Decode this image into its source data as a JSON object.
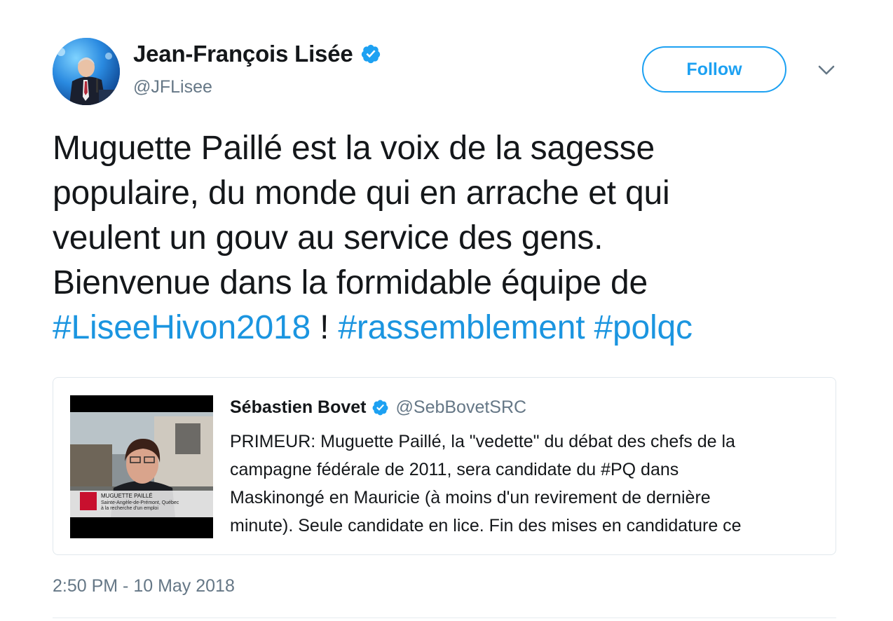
{
  "author": {
    "display_name": "Jean-François Lisée",
    "handle": "@JFLisee",
    "verified_icon": "verified-badge-icon",
    "avatar_icon": "avatar"
  },
  "actions": {
    "follow_label": "Follow",
    "more_icon": "chevron-down-icon"
  },
  "tweet": {
    "line1": "Muguette Paillé est la voix de la sagesse",
    "line2": "populaire, du monde qui en arrache et qui",
    "line3": "veulent un gouv au service des gens.",
    "line4": "Bienvenue dans la formidable équipe de",
    "hashtag1": "#LiseeHivon2018",
    "exclaim": " ! ",
    "hashtag2": "#rassemblement",
    "space": " ",
    "hashtag3": "#polqc"
  },
  "quoted_tweet": {
    "display_name": "Sébastien Bovet",
    "handle": "@SebBovetSRC",
    "text": "PRIMEUR: Muguette Paillé, la \"vedette\" du débat des chefs de la\ncampagne fédérale de 2011, sera candidate du #PQ dans\nMaskinongé en Mauricie (à moins d'un revirement de dernière\nminute). Seule candidate en lice. Fin des mises en candidature ce",
    "media": {
      "caption_name": "MUGUETTE PAILLÉ",
      "caption_line1": "Sainte-Angèle-de-Prémont, Québec",
      "caption_line2": "à la recherche d'un emploi"
    }
  },
  "timestamp": "2:50 PM - 10 May 2018",
  "colors": {
    "accent": "#1da1f2",
    "hashtag": "#1b95e0",
    "text": "#14171a",
    "secondary": "#657786"
  }
}
